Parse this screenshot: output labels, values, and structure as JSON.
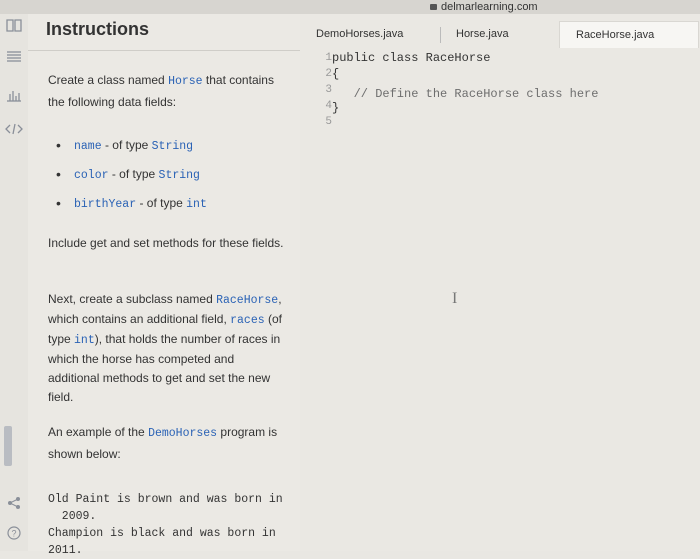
{
  "browser": {
    "url": "delmarlearning.com"
  },
  "sidebar_icons": [
    "book-icon",
    "list-icon",
    "bar-chart-icon",
    "code-icon",
    "share-icon",
    "help-icon"
  ],
  "instructions": {
    "title": "Instructions",
    "intro_pre": "Create a class named ",
    "intro_class": "Horse",
    "intro_post": " that contains the following data fields:",
    "fields": [
      {
        "name": "name",
        "sep": " - of type ",
        "type": "String"
      },
      {
        "name": "color",
        "sep": " - of type ",
        "type": "String"
      },
      {
        "name": "birthYear",
        "sep": " - of type ",
        "type": "int"
      }
    ],
    "getset": "Include get and set methods for these fields.",
    "sub_pre": "Next, create a subclass named ",
    "sub_class": "RaceHorse",
    "sub_mid1": ", which contains an additional field, ",
    "sub_field": "races",
    "sub_mid2": " (of type ",
    "sub_type": "int",
    "sub_post": "), that holds the number of races in which the horse has competed and additional methods to get and set the new field.",
    "example_pre": "An example of the ",
    "example_class": "DemoHorses",
    "example_post": " program is shown below:",
    "output_1": "Old Paint is brown and was born in\n  2009.",
    "output_2": "Champion is black and was born in\n2011."
  },
  "editor": {
    "tabs": [
      "DemoHorses.java",
      "Horse.java",
      "RaceHorse.java"
    ],
    "active_tab": 2,
    "line_numbers": [
      "1",
      "2",
      "3",
      "4",
      "5"
    ],
    "lines": [
      "public class RaceHorse",
      "{",
      "   // Define the RaceHorse class here",
      "}",
      ""
    ]
  }
}
